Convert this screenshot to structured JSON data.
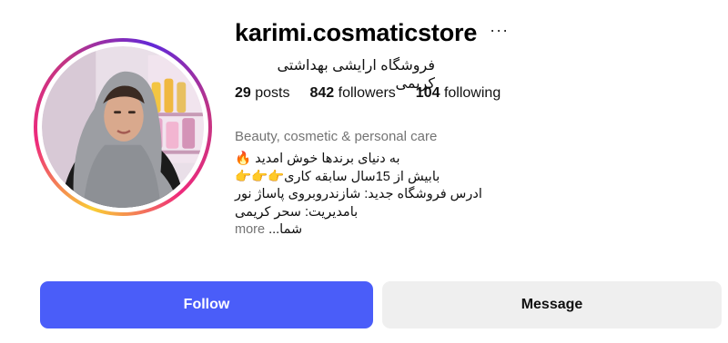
{
  "profile": {
    "username": "karimi.cosmaticstore",
    "more_options_icon": "ellipsis-icon",
    "full_name": "فروشگاه ارایشی بهداشتی کریمی",
    "stats": {
      "posts_count": "29",
      "posts_label": "posts",
      "followers_count": "842",
      "followers_label": "followers",
      "following_count": "104",
      "following_label": "following"
    },
    "category": "Beauty, cosmetic & personal care",
    "bio": {
      "line1": "به دنیای برندها خوش امدید 🔥",
      "line2": "بابیش از 15سال سابقه کاری👉👉👉",
      "line3": "ادرس فروشگاه جدید: شازندروبروی پاساژ نور",
      "line4": "بامدیریت: سحر کریمی",
      "line5_text": "شما...",
      "more_label": "more"
    }
  },
  "actions": {
    "follow_label": "Follow",
    "message_label": "Message"
  },
  "colors": {
    "follow_button": "#4a5df9",
    "message_button": "#efefef",
    "muted_text": "#737373"
  }
}
